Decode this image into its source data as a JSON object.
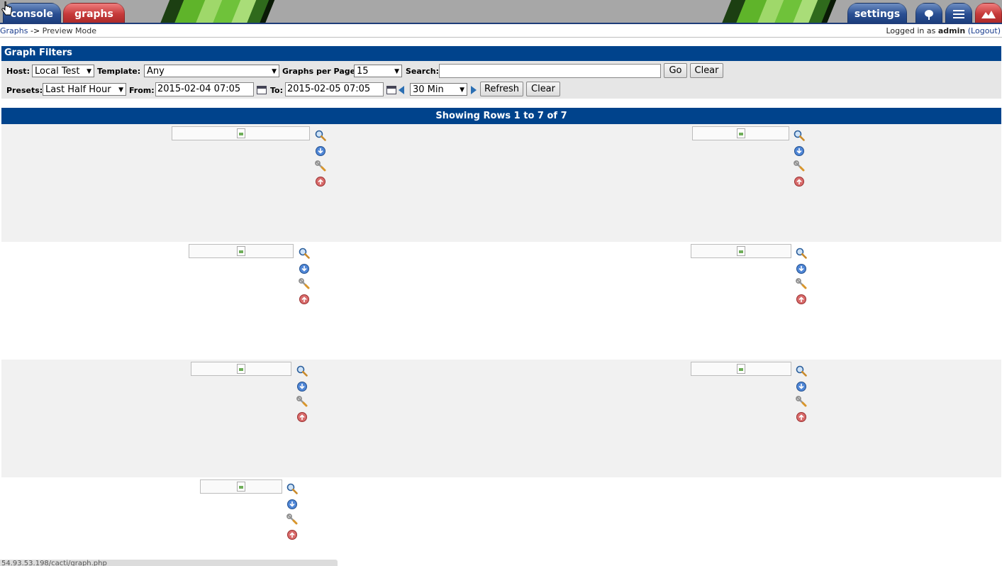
{
  "tabs": {
    "console": "console",
    "graphs": "graphs",
    "settings": "settings"
  },
  "tab_icons": [
    "tree-view-icon",
    "list-view-icon",
    "preview-mode-icon"
  ],
  "breadcrumb": {
    "root": "Graphs",
    "separator": "->",
    "current": "Preview Mode"
  },
  "login": {
    "prefix": "Logged in as",
    "user": "admin",
    "logout": "(Logout)"
  },
  "filters": {
    "title": "Graph Filters",
    "host": {
      "label": "Host:",
      "value": "Local Test"
    },
    "template": {
      "label": "Template:",
      "value": "Any"
    },
    "graphs_per_page": {
      "label": "Graphs per Page:",
      "value": "15"
    },
    "search": {
      "label": "Search:",
      "value": ""
    },
    "go": "Go",
    "clear": "Clear",
    "presets": {
      "label": "Presets:",
      "value": "Last Half Hour"
    },
    "from": {
      "label": "From:",
      "value": "2015-02-04 07:05"
    },
    "to": {
      "label": "To:",
      "value": "2015-02-05 07:05"
    },
    "timespan": {
      "value": "30 Min"
    },
    "refresh": "Refresh",
    "clear2": "Clear"
  },
  "results": {
    "header": "Showing Rows 1 to 7 of 7"
  },
  "graph_actions": [
    "zoom-icon",
    "download-icon",
    "edit-wrench-icon",
    "move-up-icon"
  ],
  "graphs_count": 7,
  "status_bar": "54.93.53.198/cacti/graph.php"
}
